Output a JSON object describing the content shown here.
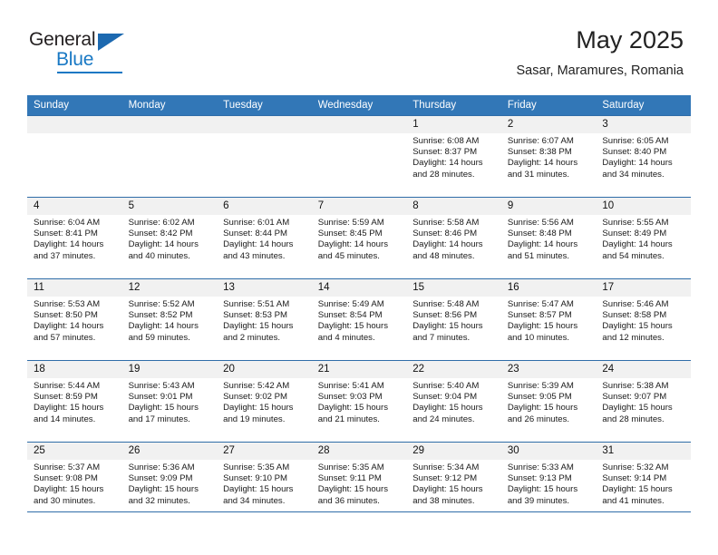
{
  "brand": {
    "name_top": "General",
    "name_bottom": "Blue",
    "accent_color": "#1878c4",
    "header_color": "#3277b7"
  },
  "header": {
    "title": "May 2025",
    "subtitle": "Sasar, Maramures, Romania"
  },
  "calendar": {
    "weekday_headers": [
      "Sunday",
      "Monday",
      "Tuesday",
      "Wednesday",
      "Thursday",
      "Friday",
      "Saturday"
    ],
    "weeks": [
      [
        {
          "day": "",
          "empty": true
        },
        {
          "day": "",
          "empty": true
        },
        {
          "day": "",
          "empty": true
        },
        {
          "day": "",
          "empty": true
        },
        {
          "day": "1",
          "sunrise": "Sunrise: 6:08 AM",
          "sunset": "Sunset: 8:37 PM",
          "daylight": "Daylight: 14 hours and 28 minutes."
        },
        {
          "day": "2",
          "sunrise": "Sunrise: 6:07 AM",
          "sunset": "Sunset: 8:38 PM",
          "daylight": "Daylight: 14 hours and 31 minutes."
        },
        {
          "day": "3",
          "sunrise": "Sunrise: 6:05 AM",
          "sunset": "Sunset: 8:40 PM",
          "daylight": "Daylight: 14 hours and 34 minutes."
        }
      ],
      [
        {
          "day": "4",
          "sunrise": "Sunrise: 6:04 AM",
          "sunset": "Sunset: 8:41 PM",
          "daylight": "Daylight: 14 hours and 37 minutes."
        },
        {
          "day": "5",
          "sunrise": "Sunrise: 6:02 AM",
          "sunset": "Sunset: 8:42 PM",
          "daylight": "Daylight: 14 hours and 40 minutes."
        },
        {
          "day": "6",
          "sunrise": "Sunrise: 6:01 AM",
          "sunset": "Sunset: 8:44 PM",
          "daylight": "Daylight: 14 hours and 43 minutes."
        },
        {
          "day": "7",
          "sunrise": "Sunrise: 5:59 AM",
          "sunset": "Sunset: 8:45 PM",
          "daylight": "Daylight: 14 hours and 45 minutes."
        },
        {
          "day": "8",
          "sunrise": "Sunrise: 5:58 AM",
          "sunset": "Sunset: 8:46 PM",
          "daylight": "Daylight: 14 hours and 48 minutes."
        },
        {
          "day": "9",
          "sunrise": "Sunrise: 5:56 AM",
          "sunset": "Sunset: 8:48 PM",
          "daylight": "Daylight: 14 hours and 51 minutes."
        },
        {
          "day": "10",
          "sunrise": "Sunrise: 5:55 AM",
          "sunset": "Sunset: 8:49 PM",
          "daylight": "Daylight: 14 hours and 54 minutes."
        }
      ],
      [
        {
          "day": "11",
          "sunrise": "Sunrise: 5:53 AM",
          "sunset": "Sunset: 8:50 PM",
          "daylight": "Daylight: 14 hours and 57 minutes."
        },
        {
          "day": "12",
          "sunrise": "Sunrise: 5:52 AM",
          "sunset": "Sunset: 8:52 PM",
          "daylight": "Daylight: 14 hours and 59 minutes."
        },
        {
          "day": "13",
          "sunrise": "Sunrise: 5:51 AM",
          "sunset": "Sunset: 8:53 PM",
          "daylight": "Daylight: 15 hours and 2 minutes."
        },
        {
          "day": "14",
          "sunrise": "Sunrise: 5:49 AM",
          "sunset": "Sunset: 8:54 PM",
          "daylight": "Daylight: 15 hours and 4 minutes."
        },
        {
          "day": "15",
          "sunrise": "Sunrise: 5:48 AM",
          "sunset": "Sunset: 8:56 PM",
          "daylight": "Daylight: 15 hours and 7 minutes."
        },
        {
          "day": "16",
          "sunrise": "Sunrise: 5:47 AM",
          "sunset": "Sunset: 8:57 PM",
          "daylight": "Daylight: 15 hours and 10 minutes."
        },
        {
          "day": "17",
          "sunrise": "Sunrise: 5:46 AM",
          "sunset": "Sunset: 8:58 PM",
          "daylight": "Daylight: 15 hours and 12 minutes."
        }
      ],
      [
        {
          "day": "18",
          "sunrise": "Sunrise: 5:44 AM",
          "sunset": "Sunset: 8:59 PM",
          "daylight": "Daylight: 15 hours and 14 minutes."
        },
        {
          "day": "19",
          "sunrise": "Sunrise: 5:43 AM",
          "sunset": "Sunset: 9:01 PM",
          "daylight": "Daylight: 15 hours and 17 minutes."
        },
        {
          "day": "20",
          "sunrise": "Sunrise: 5:42 AM",
          "sunset": "Sunset: 9:02 PM",
          "daylight": "Daylight: 15 hours and 19 minutes."
        },
        {
          "day": "21",
          "sunrise": "Sunrise: 5:41 AM",
          "sunset": "Sunset: 9:03 PM",
          "daylight": "Daylight: 15 hours and 21 minutes."
        },
        {
          "day": "22",
          "sunrise": "Sunrise: 5:40 AM",
          "sunset": "Sunset: 9:04 PM",
          "daylight": "Daylight: 15 hours and 24 minutes."
        },
        {
          "day": "23",
          "sunrise": "Sunrise: 5:39 AM",
          "sunset": "Sunset: 9:05 PM",
          "daylight": "Daylight: 15 hours and 26 minutes."
        },
        {
          "day": "24",
          "sunrise": "Sunrise: 5:38 AM",
          "sunset": "Sunset: 9:07 PM",
          "daylight": "Daylight: 15 hours and 28 minutes."
        }
      ],
      [
        {
          "day": "25",
          "sunrise": "Sunrise: 5:37 AM",
          "sunset": "Sunset: 9:08 PM",
          "daylight": "Daylight: 15 hours and 30 minutes."
        },
        {
          "day": "26",
          "sunrise": "Sunrise: 5:36 AM",
          "sunset": "Sunset: 9:09 PM",
          "daylight": "Daylight: 15 hours and 32 minutes."
        },
        {
          "day": "27",
          "sunrise": "Sunrise: 5:35 AM",
          "sunset": "Sunset: 9:10 PM",
          "daylight": "Daylight: 15 hours and 34 minutes."
        },
        {
          "day": "28",
          "sunrise": "Sunrise: 5:35 AM",
          "sunset": "Sunset: 9:11 PM",
          "daylight": "Daylight: 15 hours and 36 minutes."
        },
        {
          "day": "29",
          "sunrise": "Sunrise: 5:34 AM",
          "sunset": "Sunset: 9:12 PM",
          "daylight": "Daylight: 15 hours and 38 minutes."
        },
        {
          "day": "30",
          "sunrise": "Sunrise: 5:33 AM",
          "sunset": "Sunset: 9:13 PM",
          "daylight": "Daylight: 15 hours and 39 minutes."
        },
        {
          "day": "31",
          "sunrise": "Sunrise: 5:32 AM",
          "sunset": "Sunset: 9:14 PM",
          "daylight": "Daylight: 15 hours and 41 minutes."
        }
      ]
    ]
  }
}
